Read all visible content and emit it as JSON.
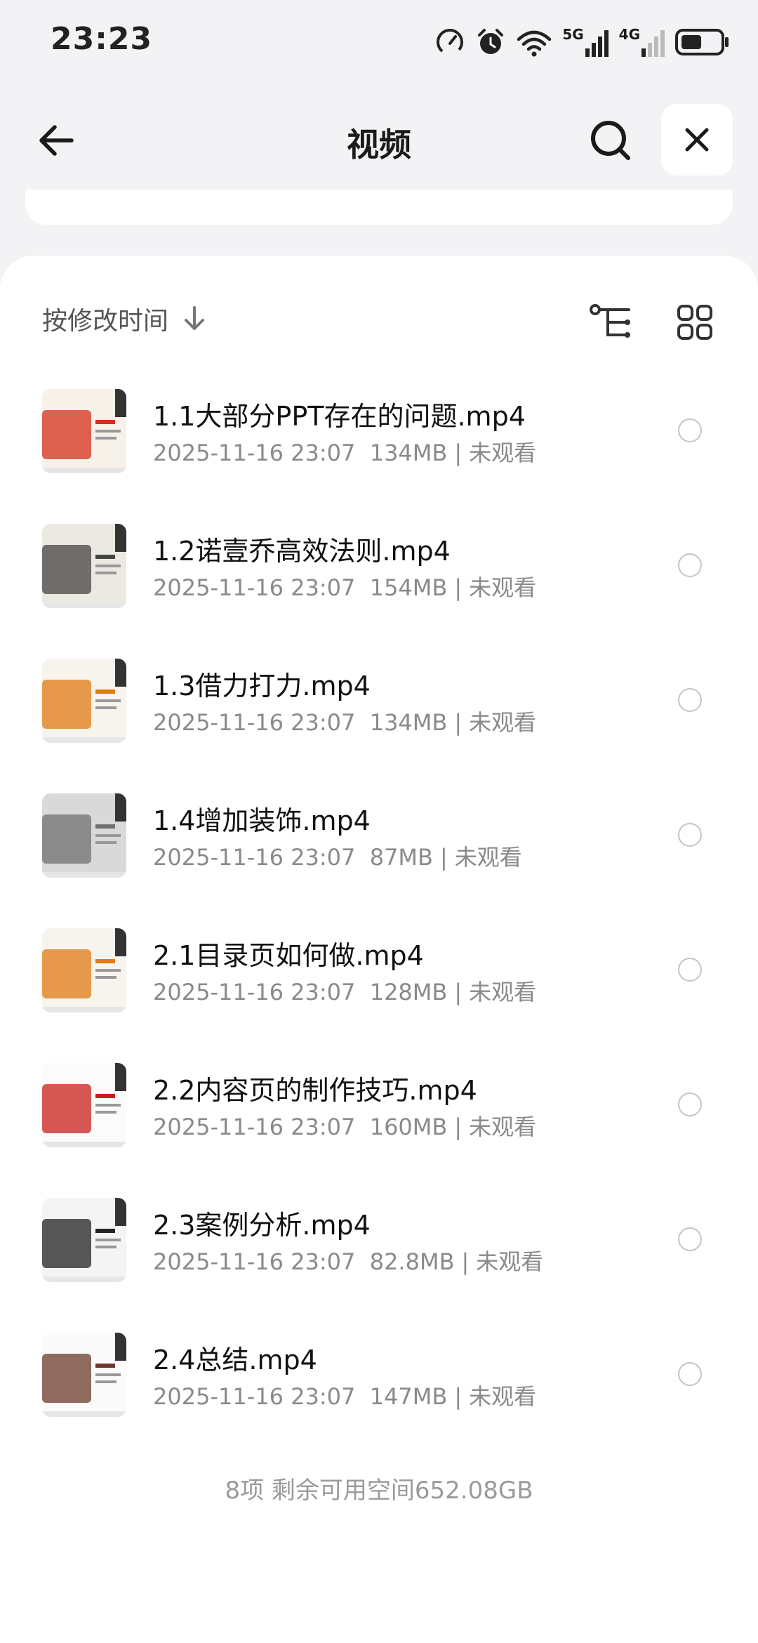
{
  "status_bar": {
    "time": "23:23",
    "network_5g": "5G",
    "network_4g": "4G"
  },
  "header": {
    "title": "视频"
  },
  "sort": {
    "label": "按修改时间"
  },
  "files": [
    {
      "name": "1.1大部分PPT存在的问题.mp4",
      "date": "2025-11-16 23:07",
      "size": "134MB",
      "status": "未观看",
      "thumb_color": "#f6f2ea",
      "thumb_accent": "#d4301a"
    },
    {
      "name": "1.2诺壹乔高效法则.mp4",
      "date": "2025-11-16 23:07",
      "size": "154MB",
      "status": "未观看",
      "thumb_color": "#ece8e2",
      "thumb_accent": "#444444"
    },
    {
      "name": "1.3借力打力.mp4",
      "date": "2025-11-16 23:07",
      "size": "134MB",
      "status": "未观看",
      "thumb_color": "#f7f4ee",
      "thumb_accent": "#e07b14"
    },
    {
      "name": "1.4增加装饰.mp4",
      "date": "2025-11-16 23:07",
      "size": "87MB",
      "status": "未观看",
      "thumb_color": "#d9d9d9",
      "thumb_accent": "#707070"
    },
    {
      "name": "2.1目录页如何做.mp4",
      "date": "2025-11-16 23:07",
      "size": "128MB",
      "status": "未观看",
      "thumb_color": "#f7f4ee",
      "thumb_accent": "#e07b14"
    },
    {
      "name": "2.2内容页的制作技巧.mp4",
      "date": "2025-11-16 23:07",
      "size": "160MB",
      "status": "未观看",
      "thumb_color": "#fbfbfb",
      "thumb_accent": "#c8201c"
    },
    {
      "name": "2.3案例分析.mp4",
      "date": "2025-11-16 23:07",
      "size": "82.8MB",
      "status": "未观看",
      "thumb_color": "#f4f4f4",
      "thumb_accent": "#222222"
    },
    {
      "name": "2.4总结.mp4",
      "date": "2025-11-16 23:07",
      "size": "147MB",
      "status": "未观看",
      "thumb_color": "#fafafa",
      "thumb_accent": "#6a3b2a"
    }
  ],
  "footer": {
    "summary": "8项 剩余可用空间652.08GB"
  },
  "icons": {
    "back": "arrow-left-icon",
    "search": "search-icon",
    "close": "close-icon",
    "sort_direction": "arrow-down-icon",
    "tree_view": "tree-view-icon",
    "grid_view": "grid-view-icon"
  }
}
